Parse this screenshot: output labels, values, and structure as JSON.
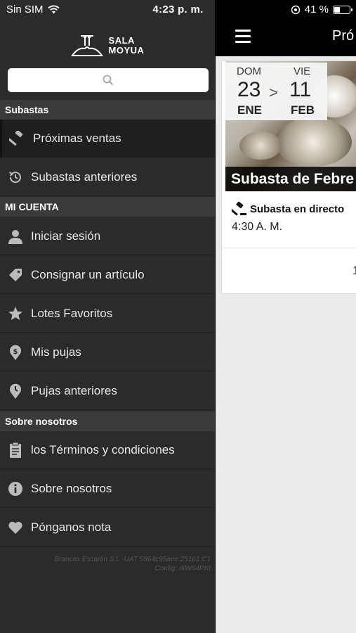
{
  "status": {
    "carrier": "Sin SIM",
    "time": "4:23 p. m.",
    "battery": "41 %",
    "battery_level": 0.41
  },
  "drawer": {
    "brand": {
      "line1": "SALA",
      "line2": "MOYUA"
    },
    "search": {
      "icon": "search-icon"
    },
    "sections": {
      "subastas": "Subastas",
      "mi_cuenta": "MI CUENTA",
      "sobre": "Sobre nosotros"
    },
    "items": {
      "proximas": {
        "label": "Próximas ventas",
        "icon": "gavel-icon"
      },
      "anteriores": {
        "label": "Subastas anteriores",
        "icon": "history-icon"
      },
      "login": {
        "label": "Iniciar sesión",
        "icon": "user-icon"
      },
      "consignar": {
        "label": "Consignar un artículo",
        "icon": "tag-icon"
      },
      "favoritos": {
        "label": "Lotes Favoritos",
        "icon": "star-icon"
      },
      "pujas": {
        "label": "Mis pujas",
        "icon": "bid-icon"
      },
      "pujas_ant": {
        "label": "Pujas anteriores",
        "icon": "pin-icon"
      },
      "terminos": {
        "label": "los Términos y condiciones",
        "icon": "document-icon"
      },
      "sobre_nos": {
        "label": "Sobre nosotros",
        "icon": "info-icon"
      },
      "pongan": {
        "label": "Pónganos nota",
        "icon": "heart-icon"
      }
    },
    "footer": {
      "line1": "Brancas Escartin S.L -UAT 5864c95aee.25161.C1",
      "line2": "Config: rkW64PKt"
    }
  },
  "main": {
    "title": "Pró",
    "card": {
      "from": {
        "dow": "DOM",
        "day": "23",
        "month": "ENE"
      },
      "sep": ">",
      "to": {
        "dow": "VIE",
        "day": "11",
        "month": "FEB"
      },
      "title": "Subasta de Febre",
      "type": "Subasta en directo",
      "time": "4:30 A. M.",
      "count": "1"
    }
  },
  "colors": {
    "drawer_bg": "#2b2b2b",
    "section_bg": "#3a3a3a",
    "nav_bg": "#000000",
    "content_bg": "#ebebeb"
  }
}
